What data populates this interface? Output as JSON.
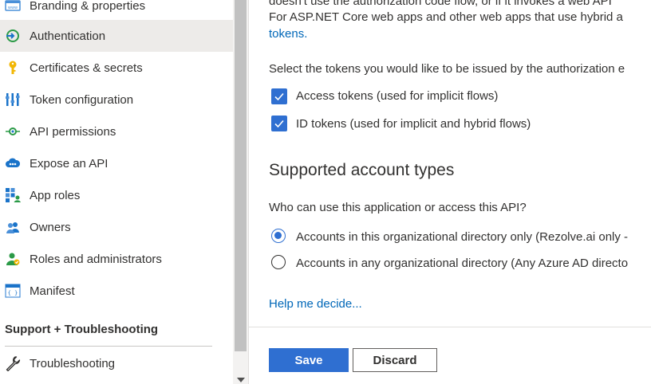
{
  "sidebar": {
    "items": [
      {
        "label": "Branding & properties",
        "icon": "branding-icon"
      },
      {
        "label": "Authentication",
        "icon": "authentication-icon",
        "active": true
      },
      {
        "label": "Certificates & secrets",
        "icon": "key-icon"
      },
      {
        "label": "Token configuration",
        "icon": "token-configuration-icon"
      },
      {
        "label": "API permissions",
        "icon": "api-permissions-icon"
      },
      {
        "label": "Expose an API",
        "icon": "cloud-api-icon"
      },
      {
        "label": "App roles",
        "icon": "app-roles-icon"
      },
      {
        "label": "Owners",
        "icon": "owners-icon"
      },
      {
        "label": "Roles and administrators",
        "icon": "roles-admin-icon"
      },
      {
        "label": "Manifest",
        "icon": "manifest-icon"
      }
    ],
    "section_title": "Support + Troubleshooting",
    "support_items": [
      {
        "label": "Troubleshooting",
        "icon": "wrench-icon"
      }
    ]
  },
  "main": {
    "intro_line1": "doesn't use the authorization code flow, or if it invokes a web API",
    "intro_line2": "For ASP.NET Core web apps and other web apps that use hybrid a",
    "intro_link": "tokens.",
    "select_tokens_text": "Select the tokens you would like to be issued by the authorization e",
    "checkboxes": [
      {
        "label": "Access tokens (used for implicit flows)",
        "checked": true
      },
      {
        "label": "ID tokens (used for implicit and hybrid flows)",
        "checked": true
      }
    ],
    "account_types_heading": "Supported account types",
    "who_can_use": "Who can use this application or access this API?",
    "radios": [
      {
        "label": "Accounts in this organizational directory only (Rezolve.ai only -",
        "checked": true
      },
      {
        "label": "Accounts in any organizational directory (Any Azure AD directo",
        "checked": false
      }
    ],
    "help_link": "Help me decide..."
  },
  "footer": {
    "save_label": "Save",
    "discard_label": "Discard"
  },
  "colors": {
    "accent": "#2f6fd1",
    "link": "#0067b8",
    "active_bg": "#edebe9"
  }
}
